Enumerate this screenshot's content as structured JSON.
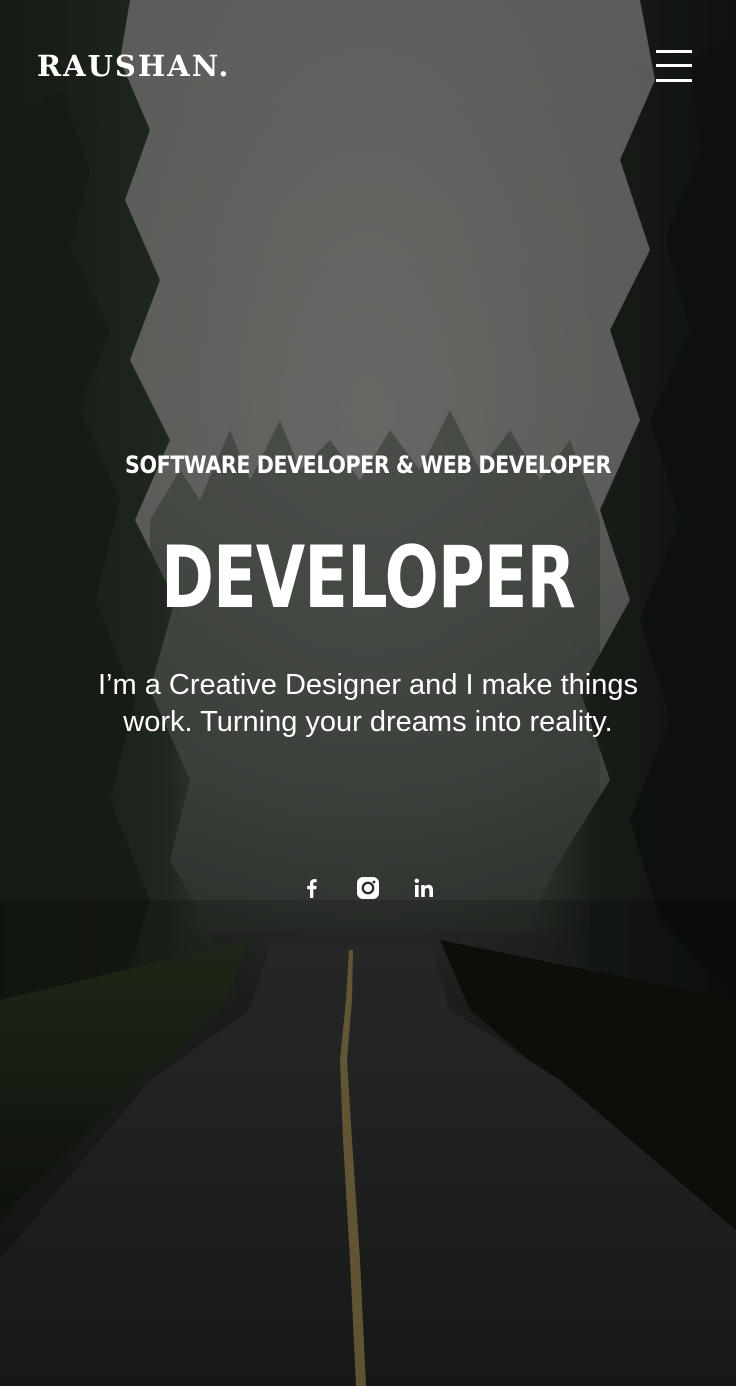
{
  "header": {
    "logo_text": "RAUSHAN.",
    "menu_icon": "hamburger-menu-icon"
  },
  "hero": {
    "subtitle": "SOFTWARE DEVELOPER & WEB DEVELOPER",
    "title": "DEVELOPER",
    "tagline": "I’m a Creative Designer and I make things work. Turning your dreams into reality.",
    "background": "foggy-forest-road-photo"
  },
  "socials": [
    {
      "network": "facebook",
      "icon": "facebook-icon"
    },
    {
      "network": "instagram",
      "icon": "instagram-icon"
    },
    {
      "network": "linkedin",
      "icon": "linkedin-icon"
    }
  ],
  "colors": {
    "text": "#ffffff",
    "fog": "#7a7c79",
    "forest_dark": "#1b1f19",
    "road": "#2d2e2e",
    "road_line": "#a38d55"
  }
}
